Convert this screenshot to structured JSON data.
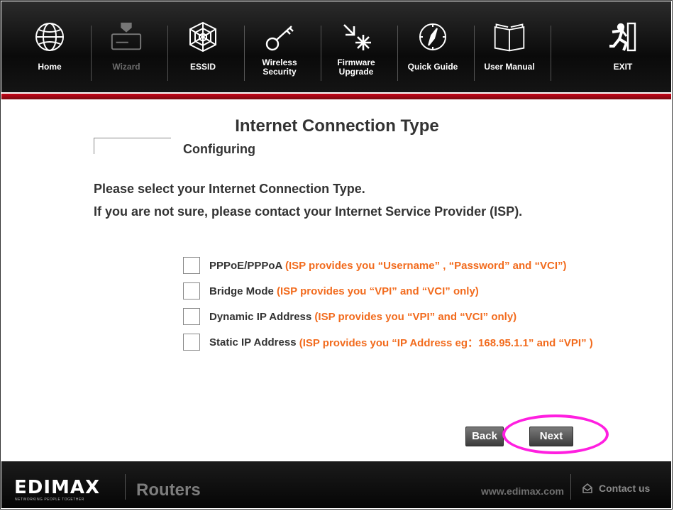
{
  "nav": {
    "items": [
      {
        "label": "Home",
        "icon": "globe-icon"
      },
      {
        "label": "Wizard",
        "icon": "wizard-icon"
      },
      {
        "label": "ESSID",
        "icon": "web-icon"
      },
      {
        "label": "Wireless\nSecurity",
        "icon": "key-icon"
      },
      {
        "label": "Firmware\nUpgrade",
        "icon": "upgrade-icon"
      },
      {
        "label": "Quick Guide",
        "icon": "compass-icon"
      },
      {
        "label": "User Manual",
        "icon": "book-icon"
      },
      {
        "label": "EXIT",
        "icon": "exit-icon"
      }
    ]
  },
  "page": {
    "title": "Internet Connection Type",
    "status": "Configuring",
    "instruction_1": "Please select your Internet Connection Type.",
    "instruction_2": "If you are not sure, please contact your Internet Service Provider (ISP)."
  },
  "options": [
    {
      "name": "PPPoE/PPPoA ",
      "desc": "(ISP provides you “Username” , “Password” and “VCI”)"
    },
    {
      "name": "Bridge Mode ",
      "desc": "(ISP provides you “VPI” and “VCI” only)"
    },
    {
      "name": "Dynamic IP Address ",
      "desc": "(ISP provides you “VPI” and “VCI” only)"
    },
    {
      "name": "Static IP Address ",
      "desc": "(ISP provides you “IP Address eg：168.95.1.1” and “VPI” )"
    }
  ],
  "buttons": {
    "back": "Back",
    "next": "Next"
  },
  "footer": {
    "brand": "EDIMAX",
    "tagline": "NETWORKING PEOPLE TOGETHER",
    "product": "Routers",
    "url": "www.edimax.com",
    "contact": "Contact us"
  },
  "colors": {
    "accent_red": "#c9071a",
    "option_desc": "#f26b1d",
    "highlight": "#ff1fe0"
  }
}
